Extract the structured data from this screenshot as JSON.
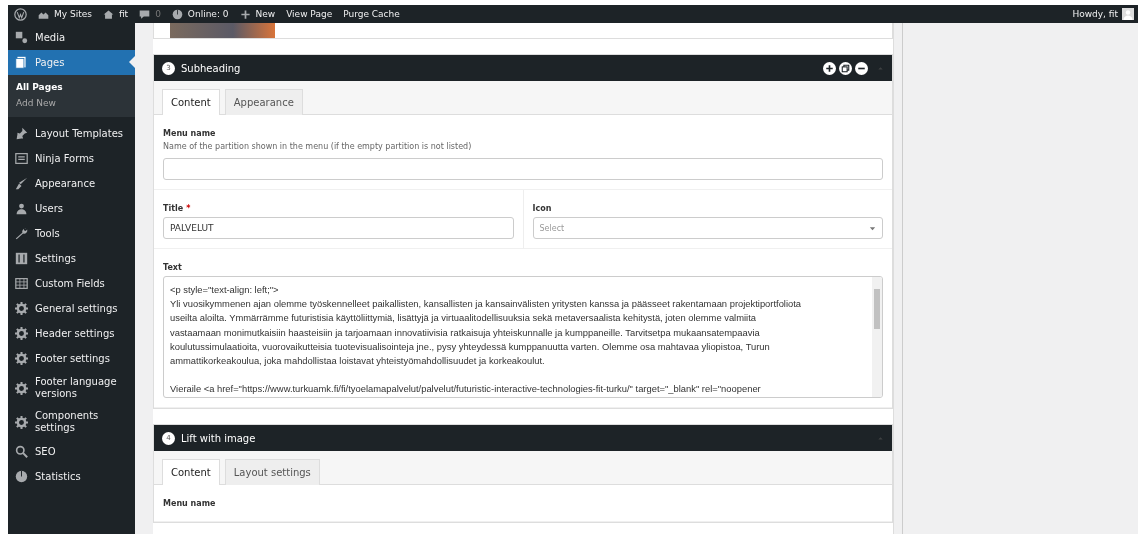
{
  "admin_bar": {
    "items": [
      {
        "kind": "logo"
      },
      {
        "kind": "sites",
        "label": "My Sites"
      },
      {
        "kind": "home",
        "label": "fit"
      },
      {
        "kind": "comments",
        "label": "0"
      },
      {
        "kind": "online",
        "label": "Online: 0"
      },
      {
        "kind": "new",
        "label": "New"
      },
      {
        "kind": "text",
        "label": "View Page"
      },
      {
        "kind": "text",
        "label": "Purge Cache"
      }
    ],
    "greeting": "Howdy, fit"
  },
  "sidebar": {
    "items": [
      {
        "label": "Media",
        "selected": false
      },
      {
        "label": "Pages",
        "selected": true,
        "children": [
          {
            "label": "All Pages",
            "selected": true
          },
          {
            "label": "Add New",
            "selected": false
          }
        ]
      },
      {
        "label": "Layout Templates",
        "selected": false
      },
      {
        "label": "Ninja Forms",
        "selected": false
      },
      {
        "label": "Appearance",
        "selected": false
      },
      {
        "label": "Users",
        "selected": false
      },
      {
        "label": "Tools",
        "selected": false
      },
      {
        "label": "Settings",
        "selected": false
      },
      {
        "label": "Custom Fields",
        "selected": false
      },
      {
        "label": "General settings",
        "selected": false
      },
      {
        "label": "Header settings",
        "selected": false
      },
      {
        "label": "Footer settings",
        "selected": false
      },
      {
        "label": "Footer language versions",
        "selected": false
      },
      {
        "label": "Components settings",
        "selected": false
      },
      {
        "label": "SEO",
        "selected": false
      },
      {
        "label": "Statistics",
        "selected": false
      }
    ]
  },
  "sections": [
    {
      "number": "3",
      "title": "Subheading",
      "actions": true,
      "tabs": [
        {
          "label": "Content",
          "selected": true
        },
        {
          "label": "Appearance",
          "selected": false
        }
      ],
      "fields": {
        "menu_name": {
          "label": "Menu name",
          "help": "Name of the partition shown in the menu (if the empty partition is not listed)"
        },
        "title": {
          "label": "Title",
          "required_mark": "*",
          "value": "PALVELUT"
        },
        "icon": {
          "label": "Icon",
          "placeholder": "Select"
        },
        "text": {
          "label": "Text",
          "paragraphs": [
            [
              "<p style=\"text-align: left;\">",
              "Yli vuosikymmenen ajan olemme työskennelleet paikallisten, kansallisten ja kansainvälisten yritysten kanssa ja päässeet rakentamaan projektiportfoliota",
              "useilta aloilta. Ymmärrämme futuristisia käyttöliittymiä, lisättyjä ja virtuaalitodellisuuksia sekä metaversaalista kehitystä, joten olemme valmiita",
              "vastaamaan monimutkaisiin haasteisiin ja tarjoamaan innovatiivisia ratkaisuja yhteiskunnalle ja kumppaneille. Tarvitsetpa mukaansatempaavia",
              "koulutussimulaatioita, vuorovaikutteisia tuotevisualisointeja jne., pysy yhteydessä kumppanuutta varten. Olemme osa mahtavaa yliopistoa, Turun",
              "ammattikorkeakoulua, joka mahdollistaa loistavat yhteistyömahdollisuudet ja korkeakoulut."
            ],
            [
              "Vieraile <a href=\"https://www.turkuamk.fi/fi/tyoelamapalvelut/palvelut/futuristic-interactive-technologies-fit-turku/\" target=\"_blank\" rel=\"noopener"
            ]
          ]
        }
      }
    },
    {
      "number": "4",
      "title": "Lift with image",
      "actions": false,
      "tabs": [
        {
          "label": "Content",
          "selected": true
        },
        {
          "label": "Layout settings",
          "selected": false
        }
      ],
      "fields": {
        "menu_name": {
          "label": "Menu name"
        }
      }
    }
  ]
}
